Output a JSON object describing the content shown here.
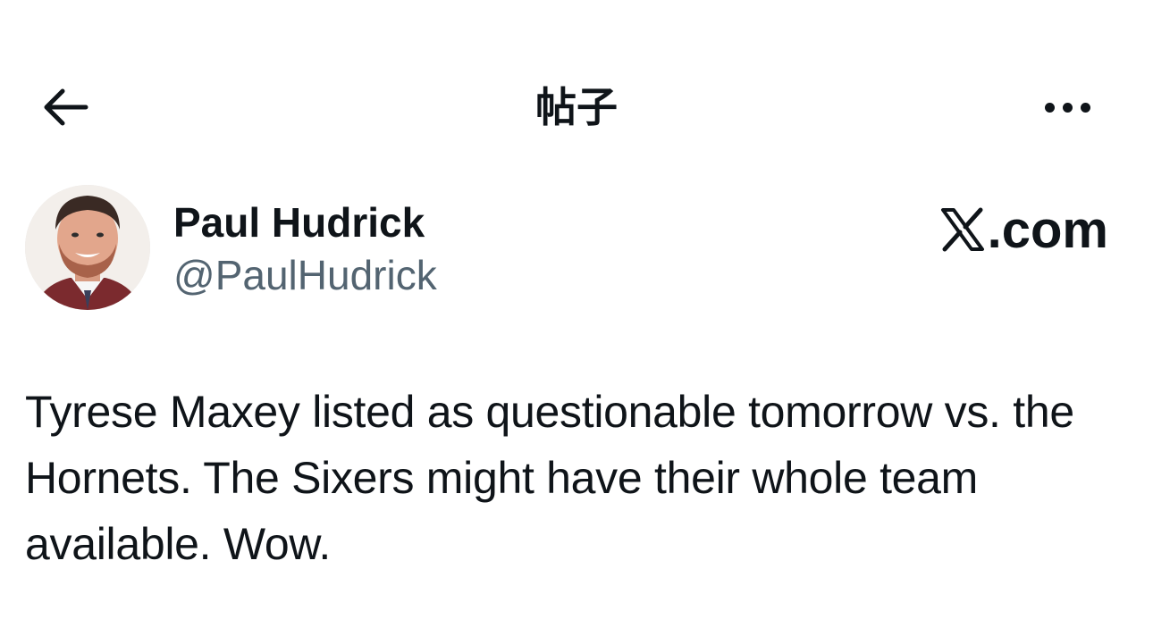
{
  "header": {
    "title": "帖子",
    "back_icon": "arrow-left-icon",
    "more_icon": "more-horizontal-icon"
  },
  "author": {
    "name": "Paul Hudrick",
    "handle": "@PaulHudrick"
  },
  "brand": {
    "label": ".com",
    "icon": "x-logo-icon"
  },
  "post": {
    "text": "Tyrese Maxey listed as questionable tomorrow vs. the Hornets. The Sixers might have their whole team available. Wow."
  },
  "colors": {
    "text_primary": "#0f1419",
    "text_secondary": "#536471",
    "background": "#ffffff"
  }
}
